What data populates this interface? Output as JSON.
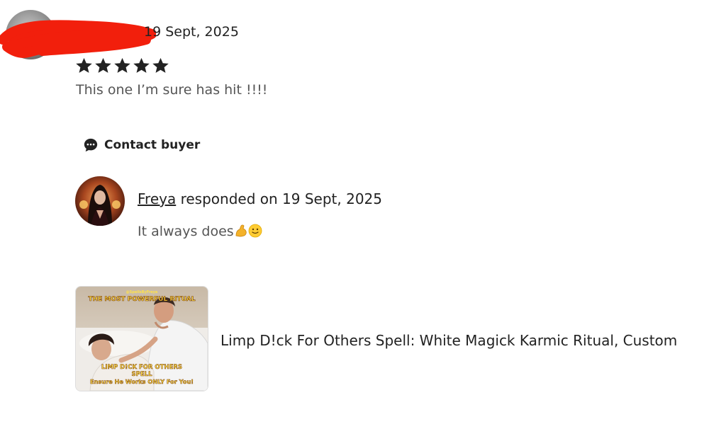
{
  "review": {
    "date": "19 Sept, 2025",
    "rating": 5,
    "text": "This one I’m sure has hit !!!!"
  },
  "contact": {
    "label": "Contact buyer"
  },
  "response": {
    "seller_name": "Freya",
    "responded_text": " responded on 19 Sept, 2025",
    "text": "It always does"
  },
  "listing": {
    "title": "Limp D!ck For Others Spell: White Magick Karmic Ritual, Custom",
    "thumbnail": {
      "top_caption": "THE MOST POWERFUL RITUAL",
      "bottom_caption_1": "LIMP D!CK FOR OTHERS",
      "bottom_caption_2": "SPELL",
      "bottom_caption_3": "Ensure He Works ONLY For You!"
    }
  },
  "colors": {
    "redaction": "#f21f0c",
    "star": "#222222",
    "thumb_caption": "#ffe24a"
  }
}
